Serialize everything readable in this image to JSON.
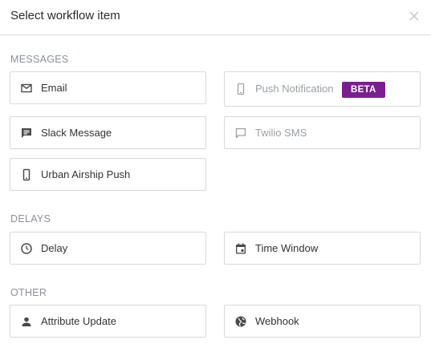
{
  "header": {
    "title": "Select workflow item"
  },
  "sections": {
    "messages": {
      "title": "MESSAGES",
      "items": [
        {
          "label": "Email",
          "icon": "mail-icon"
        },
        {
          "label": "Push Notification",
          "icon": "smartphone-icon",
          "badge": "BETA",
          "disabled": true
        },
        {
          "label": "Slack Message",
          "icon": "chat-bubble-icon"
        },
        {
          "label": "Twilio SMS",
          "icon": "chat-bubble-outline-icon",
          "disabled": true
        },
        {
          "label": "Urban Airship Push",
          "icon": "smartphone-icon"
        }
      ]
    },
    "delays": {
      "title": "DELAYS",
      "items": [
        {
          "label": "Delay",
          "icon": "clock-icon"
        },
        {
          "label": "Time Window",
          "icon": "calendar-icon"
        }
      ]
    },
    "other": {
      "title": "OTHER",
      "items": [
        {
          "label": "Attribute Update",
          "icon": "person-icon"
        },
        {
          "label": "Webhook",
          "icon": "globe-icon"
        }
      ]
    }
  },
  "colors": {
    "badge": "#7a1f8f",
    "section_title": "#8a9099",
    "border": "#d9d9d9",
    "disabled_text": "#9aa0a6"
  }
}
